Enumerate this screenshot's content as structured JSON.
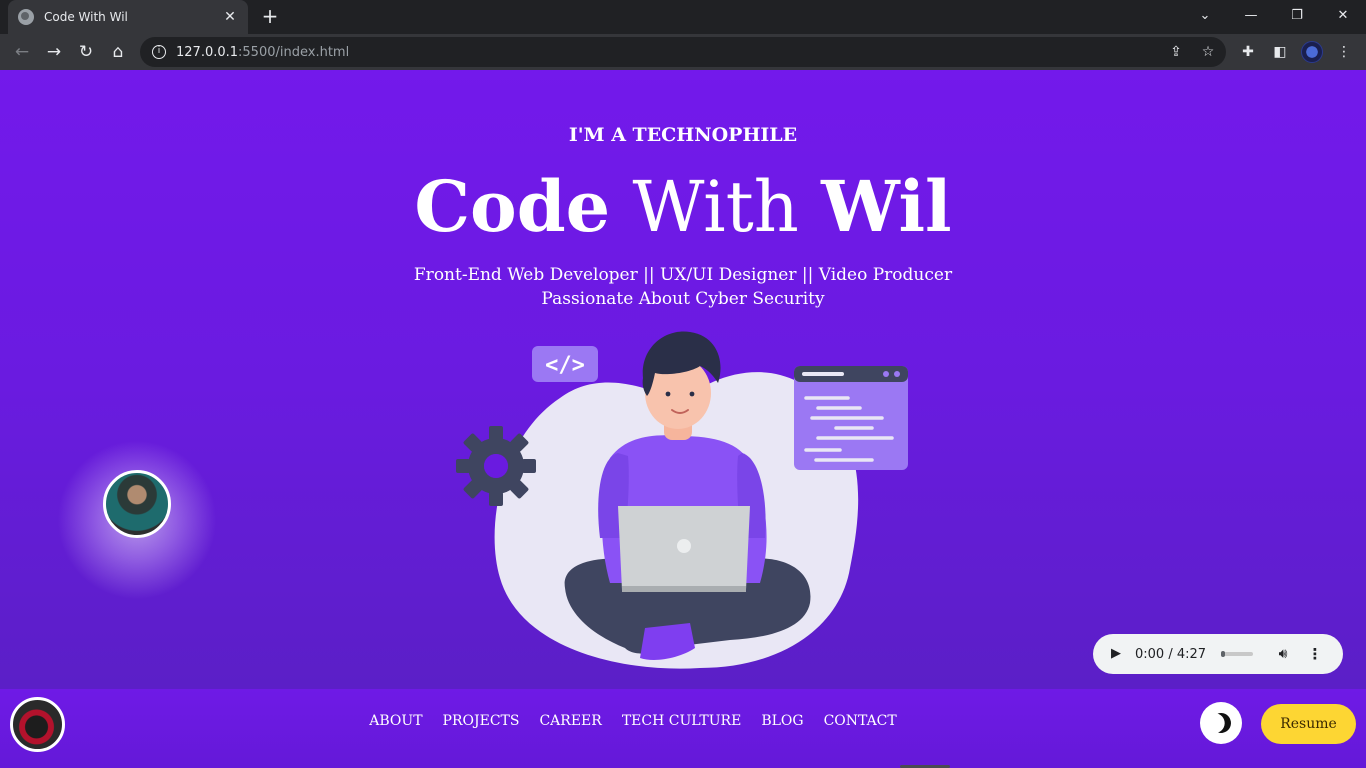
{
  "browser": {
    "tab_title": "Code With Wil",
    "url_host": "127.0.0.1",
    "url_rest": ":5500/index.html",
    "icons": [
      "back-icon",
      "forward-icon",
      "reload-icon",
      "home-icon",
      "info-icon",
      "share-icon",
      "star-icon",
      "extensions-icon",
      "sidepanel-icon",
      "menu-icon"
    ],
    "window_controls": {
      "dropdown": "⌄",
      "minimize": "—",
      "restore": "❐",
      "close": "✕"
    }
  },
  "hero": {
    "eyebrow": "I'M A TECHNOPHILE",
    "title_part1": "Code",
    "title_part2": "With",
    "title_part3": "Wil",
    "tagline_line1": "Front-End Web Developer || UX/UI Designer || Video Producer",
    "tagline_line2": "Passionate About Cyber Security"
  },
  "audio_player": {
    "time": "0:00 / 4:27",
    "progress": 0.0
  },
  "navbar": {
    "links": [
      "ABOUT",
      "PROJECTS",
      "CAREER",
      "TECH CULTURE",
      "BLOG",
      "CONTACT"
    ],
    "resume_label": "Resume"
  },
  "colors": {
    "page_purple": "#7319eb",
    "nav_purple": "#6f1ae6",
    "resume_yellow": "#fdd633",
    "chrome_dark": "#202124",
    "chrome_toolbar": "#35363a"
  }
}
